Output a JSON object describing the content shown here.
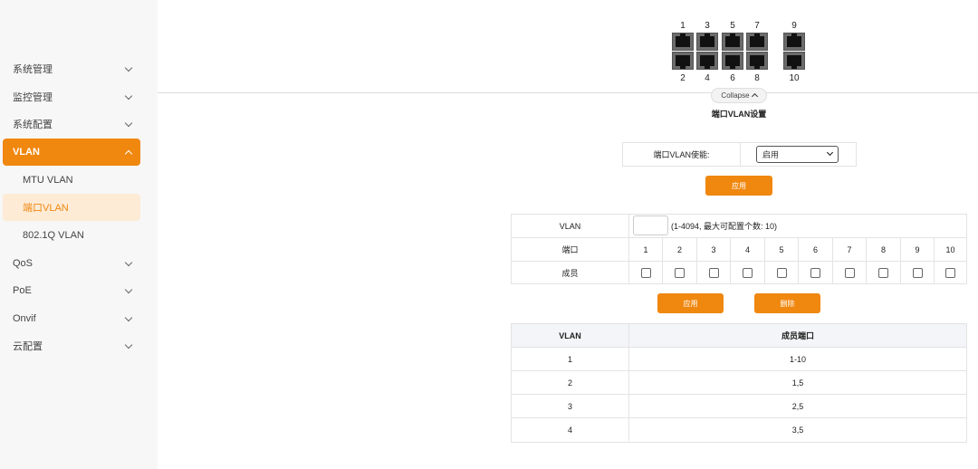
{
  "sidebar": {
    "items": [
      {
        "label": "系统管理"
      },
      {
        "label": "监控管理"
      },
      {
        "label": "系统配置"
      },
      {
        "label": "VLAN"
      },
      {
        "label": "QoS"
      },
      {
        "label": "PoE"
      },
      {
        "label": "Onvif"
      },
      {
        "label": "云配置"
      }
    ],
    "vlan_sub": [
      {
        "label": "MTU VLAN"
      },
      {
        "label": "端口VLAN"
      },
      {
        "label": "802.1Q VLAN"
      }
    ]
  },
  "ports": {
    "top": [
      "1",
      "3",
      "5",
      "7",
      "9"
    ],
    "bottom": [
      "2",
      "4",
      "6",
      "8",
      "10"
    ]
  },
  "collapse_label": "Collapse",
  "section_title": "端口VLAN设置",
  "enable": {
    "label": "端口VLAN使能:",
    "value": "启用"
  },
  "apply_label": "应用",
  "config": {
    "vlan_label": "VLAN",
    "vlan_hint": "(1-4094, 最大可配置个数: 10)",
    "port_label": "端口",
    "member_label": "成员",
    "ports": [
      "1",
      "2",
      "3",
      "4",
      "5",
      "6",
      "7",
      "8",
      "9",
      "10"
    ],
    "members_checked": [
      false,
      false,
      false,
      false,
      false,
      false,
      false,
      false,
      false,
      false
    ]
  },
  "config_apply_label": "应用",
  "delete_label": "删除",
  "result_table": {
    "headers": [
      "VLAN",
      "成员端口"
    ],
    "rows": [
      [
        "1",
        "1-10"
      ],
      [
        "2",
        "1,5"
      ],
      [
        "3",
        "2,5"
      ],
      [
        "4",
        "3,5"
      ]
    ]
  },
  "colors": {
    "accent": "#f0870f",
    "accent_light": "#fdebd6",
    "sidebar_bg": "#f7f7f7"
  }
}
